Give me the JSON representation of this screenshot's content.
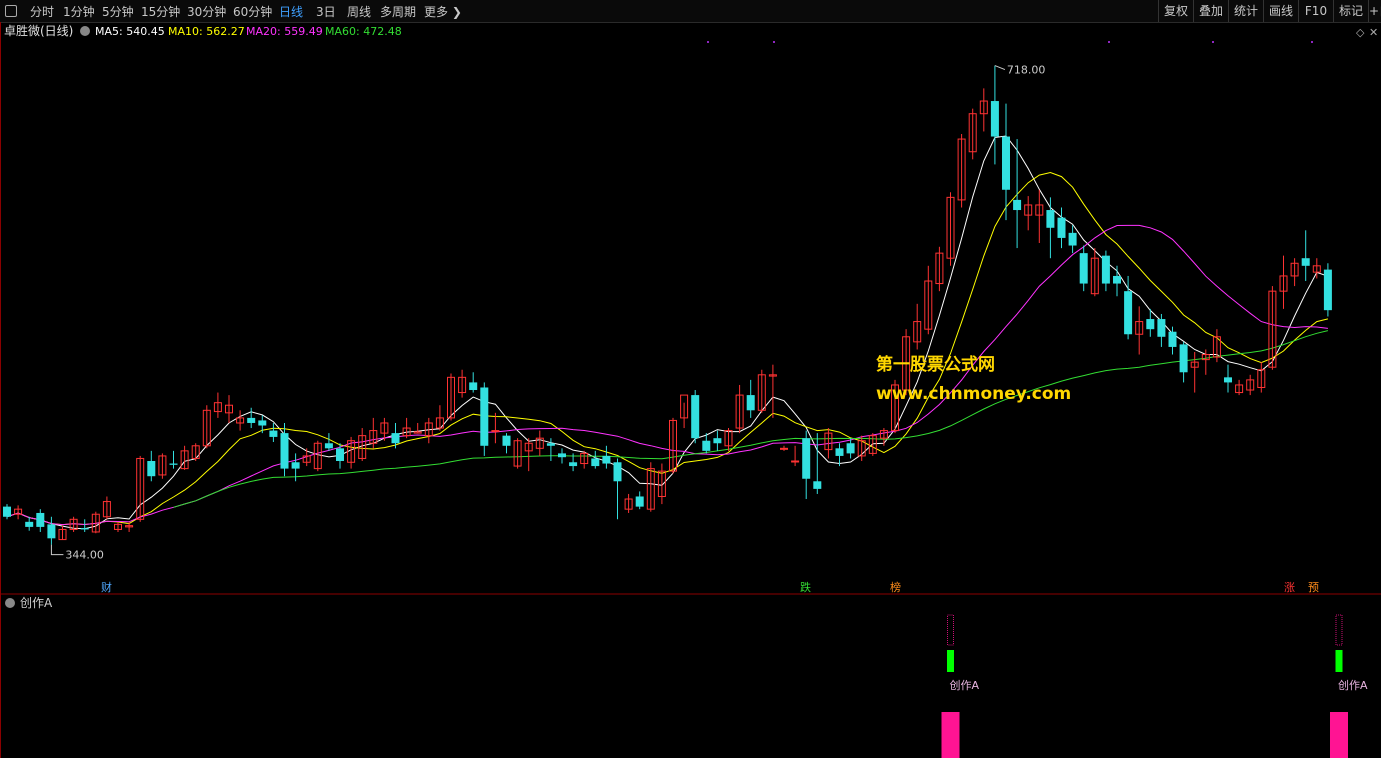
{
  "toolbar": {
    "periods": [
      "分时",
      "1分钟",
      "5分钟",
      "15分钟",
      "30分钟",
      "60分钟",
      "日线",
      "3日",
      "周线",
      "多周期",
      "更多"
    ],
    "active": "日线",
    "right_buttons": [
      "复权",
      "叠加",
      "统计",
      "画线",
      "F10",
      "标记",
      "+自"
    ]
  },
  "main_chart": {
    "stock_name": "卓胜微(日线)",
    "ma": [
      {
        "label": "MA5: 540.45",
        "color": "#ffffff"
      },
      {
        "label": "MA10: 562.27",
        "color": "#ffff00"
      },
      {
        "label": "MA20: 559.49",
        "color": "#ff33ff"
      },
      {
        "label": "MA60: 472.48",
        "color": "#33dd33"
      }
    ],
    "high_label": "718.00",
    "low_label": "344.00",
    "tags": [
      {
        "text": "财",
        "color": "#4fa8ff"
      },
      {
        "text": "跌",
        "color": "#33dd33"
      },
      {
        "text": "榜",
        "color": "#ff8c1a"
      },
      {
        "text": "涨",
        "color": "#ff3333"
      },
      {
        "text": "预",
        "color": "#ff8c1a"
      }
    ]
  },
  "watermark": {
    "line1": "第一股票公式网",
    "line2": "www.chnmoney.com"
  },
  "indicator": {
    "title": "创作A",
    "signal_label": "创作A"
  },
  "colors": {
    "up": "#ff3333",
    "down": "#33e0e0",
    "signal_green": "#00ff00",
    "signal_pink": "#ff1493"
  },
  "chart_data": {
    "type": "candlestick",
    "ohlc": [
      {
        "o": 370,
        "h": 372,
        "l": 360,
        "c": 362
      },
      {
        "o": 364,
        "h": 371,
        "l": 360,
        "c": 368
      },
      {
        "o": 358,
        "h": 362,
        "l": 351,
        "c": 354
      },
      {
        "o": 365,
        "h": 368,
        "l": 350,
        "c": 354
      },
      {
        "o": 356,
        "h": 362,
        "l": 340,
        "c": 345
      },
      {
        "o": 344,
        "h": 355,
        "l": 344,
        "c": 352
      },
      {
        "o": 352,
        "h": 362,
        "l": 350,
        "c": 360
      },
      {
        "o": 353,
        "h": 360,
        "l": 350,
        "c": 352
      },
      {
        "o": 350,
        "h": 366,
        "l": 349,
        "c": 364
      },
      {
        "o": 362,
        "h": 378,
        "l": 360,
        "c": 374
      },
      {
        "o": 352,
        "h": 358,
        "l": 350,
        "c": 356
      },
      {
        "o": 354,
        "h": 358,
        "l": 350,
        "c": 355
      },
      {
        "o": 360,
        "h": 410,
        "l": 358,
        "c": 408
      },
      {
        "o": 406,
        "h": 414,
        "l": 390,
        "c": 394
      },
      {
        "o": 395,
        "h": 412,
        "l": 392,
        "c": 410
      },
      {
        "o": 404,
        "h": 414,
        "l": 400,
        "c": 403
      },
      {
        "o": 400,
        "h": 418,
        "l": 399,
        "c": 414
      },
      {
        "o": 408,
        "h": 420,
        "l": 406,
        "c": 418
      },
      {
        "o": 418,
        "h": 450,
        "l": 416,
        "c": 446
      },
      {
        "o": 445,
        "h": 460,
        "l": 440,
        "c": 452
      },
      {
        "o": 444,
        "h": 458,
        "l": 436,
        "c": 450
      },
      {
        "o": 436,
        "h": 446,
        "l": 430,
        "c": 440
      },
      {
        "o": 440,
        "h": 448,
        "l": 432,
        "c": 436
      },
      {
        "o": 438,
        "h": 442,
        "l": 428,
        "c": 434
      },
      {
        "o": 430,
        "h": 436,
        "l": 421,
        "c": 425
      },
      {
        "o": 428,
        "h": 436,
        "l": 394,
        "c": 400
      },
      {
        "o": 405,
        "h": 412,
        "l": 390,
        "c": 400
      },
      {
        "o": 405,
        "h": 416,
        "l": 402,
        "c": 410
      },
      {
        "o": 400,
        "h": 422,
        "l": 398,
        "c": 420
      },
      {
        "o": 420,
        "h": 428,
        "l": 414,
        "c": 416
      },
      {
        "o": 416,
        "h": 420,
        "l": 400,
        "c": 406
      },
      {
        "o": 405,
        "h": 425,
        "l": 400,
        "c": 422
      },
      {
        "o": 408,
        "h": 432,
        "l": 406,
        "c": 426
      },
      {
        "o": 420,
        "h": 440,
        "l": 416,
        "c": 430
      },
      {
        "o": 428,
        "h": 440,
        "l": 422,
        "c": 436
      },
      {
        "o": 428,
        "h": 436,
        "l": 416,
        "c": 420
      },
      {
        "o": 426,
        "h": 440,
        "l": 424,
        "c": 432
      },
      {
        "o": 428,
        "h": 436,
        "l": 428,
        "c": 429
      },
      {
        "o": 426,
        "h": 440,
        "l": 420,
        "c": 436
      },
      {
        "o": 432,
        "h": 450,
        "l": 430,
        "c": 440
      },
      {
        "o": 440,
        "h": 475,
        "l": 438,
        "c": 472
      },
      {
        "o": 460,
        "h": 478,
        "l": 456,
        "c": 472
      },
      {
        "o": 468,
        "h": 476,
        "l": 460,
        "c": 462
      },
      {
        "o": 464,
        "h": 468,
        "l": 410,
        "c": 418
      },
      {
        "o": 430,
        "h": 444,
        "l": 420,
        "c": 430
      },
      {
        "o": 426,
        "h": 428,
        "l": 412,
        "c": 418
      },
      {
        "o": 402,
        "h": 424,
        "l": 400,
        "c": 422
      },
      {
        "o": 414,
        "h": 424,
        "l": 398,
        "c": 420
      },
      {
        "o": 416,
        "h": 430,
        "l": 410,
        "c": 424
      },
      {
        "o": 420,
        "h": 424,
        "l": 406,
        "c": 418
      },
      {
        "o": 412,
        "h": 416,
        "l": 404,
        "c": 409
      },
      {
        "o": 405,
        "h": 412,
        "l": 398,
        "c": 402
      },
      {
        "o": 404,
        "h": 414,
        "l": 400,
        "c": 412
      },
      {
        "o": 408,
        "h": 414,
        "l": 400,
        "c": 402
      },
      {
        "o": 410,
        "h": 418,
        "l": 400,
        "c": 404
      },
      {
        "o": 405,
        "h": 408,
        "l": 360,
        "c": 390
      },
      {
        "o": 368,
        "h": 380,
        "l": 365,
        "c": 376
      },
      {
        "o": 378,
        "h": 382,
        "l": 368,
        "c": 370
      },
      {
        "o": 368,
        "h": 405,
        "l": 366,
        "c": 400
      },
      {
        "o": 378,
        "h": 404,
        "l": 372,
        "c": 398
      },
      {
        "o": 398,
        "h": 440,
        "l": 396,
        "c": 438
      },
      {
        "o": 440,
        "h": 452,
        "l": 432,
        "c": 458
      },
      {
        "o": 458,
        "h": 462,
        "l": 420,
        "c": 424
      },
      {
        "o": 422,
        "h": 428,
        "l": 412,
        "c": 414
      },
      {
        "o": 424,
        "h": 430,
        "l": 414,
        "c": 420
      },
      {
        "o": 418,
        "h": 432,
        "l": 414,
        "c": 430
      },
      {
        "o": 432,
        "h": 466,
        "l": 428,
        "c": 458
      },
      {
        "o": 458,
        "h": 470,
        "l": 440,
        "c": 446
      },
      {
        "o": 446,
        "h": 478,
        "l": 444,
        "c": 474
      },
      {
        "o": 473,
        "h": 482,
        "l": 440,
        "c": 474
      },
      {
        "o": 416,
        "h": 418,
        "l": 414,
        "c": 416
      },
      {
        "o": 406,
        "h": 418,
        "l": 402,
        "c": 406
      },
      {
        "o": 424,
        "h": 430,
        "l": 376,
        "c": 392
      },
      {
        "o": 390,
        "h": 428,
        "l": 380,
        "c": 384
      },
      {
        "o": 415,
        "h": 432,
        "l": 408,
        "c": 428
      },
      {
        "o": 416,
        "h": 420,
        "l": 402,
        "c": 410
      },
      {
        "o": 420,
        "h": 424,
        "l": 408,
        "c": 412
      },
      {
        "o": 410,
        "h": 426,
        "l": 406,
        "c": 422
      },
      {
        "o": 412,
        "h": 428,
        "l": 410,
        "c": 426
      },
      {
        "o": 424,
        "h": 432,
        "l": 418,
        "c": 430
      },
      {
        "o": 430,
        "h": 470,
        "l": 428,
        "c": 466
      },
      {
        "o": 462,
        "h": 510,
        "l": 458,
        "c": 504
      },
      {
        "o": 500,
        "h": 530,
        "l": 494,
        "c": 516
      },
      {
        "o": 510,
        "h": 560,
        "l": 506,
        "c": 548
      },
      {
        "o": 546,
        "h": 575,
        "l": 540,
        "c": 570
      },
      {
        "o": 566,
        "h": 618,
        "l": 560,
        "c": 614
      },
      {
        "o": 612,
        "h": 664,
        "l": 606,
        "c": 660
      },
      {
        "o": 650,
        "h": 684,
        "l": 644,
        "c": 680
      },
      {
        "o": 680,
        "h": 700,
        "l": 666,
        "c": 690
      },
      {
        "o": 690,
        "h": 718,
        "l": 640,
        "c": 662
      },
      {
        "o": 662,
        "h": 688,
        "l": 596,
        "c": 620
      },
      {
        "o": 612,
        "h": 660,
        "l": 574,
        "c": 604
      },
      {
        "o": 600,
        "h": 615,
        "l": 588,
        "c": 608
      },
      {
        "o": 600,
        "h": 620,
        "l": 578,
        "c": 608
      },
      {
        "o": 604,
        "h": 614,
        "l": 566,
        "c": 590
      },
      {
        "o": 598,
        "h": 606,
        "l": 574,
        "c": 582
      },
      {
        "o": 586,
        "h": 592,
        "l": 570,
        "c": 576
      },
      {
        "o": 570,
        "h": 576,
        "l": 540,
        "c": 546
      },
      {
        "o": 538,
        "h": 574,
        "l": 536,
        "c": 566
      },
      {
        "o": 568,
        "h": 572,
        "l": 540,
        "c": 546
      },
      {
        "o": 552,
        "h": 560,
        "l": 536,
        "c": 546
      },
      {
        "o": 540,
        "h": 552,
        "l": 502,
        "c": 506
      },
      {
        "o": 506,
        "h": 528,
        "l": 490,
        "c": 516
      },
      {
        "o": 518,
        "h": 526,
        "l": 504,
        "c": 510
      },
      {
        "o": 518,
        "h": 522,
        "l": 496,
        "c": 504
      },
      {
        "o": 508,
        "h": 512,
        "l": 490,
        "c": 496
      },
      {
        "o": 498,
        "h": 500,
        "l": 468,
        "c": 476
      },
      {
        "o": 480,
        "h": 492,
        "l": 460,
        "c": 484
      },
      {
        "o": 486,
        "h": 494,
        "l": 474,
        "c": 490
      },
      {
        "o": 488,
        "h": 510,
        "l": 484,
        "c": 504
      },
      {
        "o": 472,
        "h": 482,
        "l": 460,
        "c": 468
      },
      {
        "o": 460,
        "h": 470,
        "l": 458,
        "c": 466
      },
      {
        "o": 462,
        "h": 474,
        "l": 458,
        "c": 470
      },
      {
        "o": 464,
        "h": 484,
        "l": 460,
        "c": 478
      },
      {
        "o": 480,
        "h": 544,
        "l": 478,
        "c": 540
      },
      {
        "o": 540,
        "h": 568,
        "l": 526,
        "c": 552
      },
      {
        "o": 552,
        "h": 566,
        "l": 544,
        "c": 562
      },
      {
        "o": 566,
        "h": 588,
        "l": 548,
        "c": 560
      },
      {
        "o": 555,
        "h": 566,
        "l": 550,
        "c": 560
      },
      {
        "o": 557,
        "h": 562,
        "l": 520,
        "c": 525
      }
    ],
    "ma_last": {
      "MA5": 540.45,
      "MA10": 562.27,
      "MA20": 559.49,
      "MA60": 472.48
    },
    "ylim": [
      320,
      735
    ],
    "signal_bars": [
      85,
      120
    ]
  }
}
